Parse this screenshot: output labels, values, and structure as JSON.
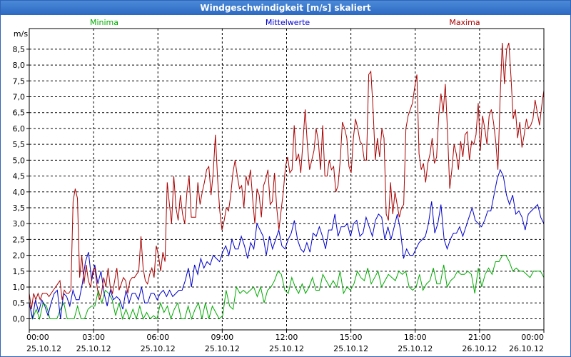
{
  "window": {
    "title": "Windgeschwindigkeit [m/s] skaliert"
  },
  "colors": {
    "min": "#00aa00",
    "mean": "#0000cc",
    "max": "#aa0000",
    "grid": "#000000"
  },
  "chart_data": {
    "type": "line",
    "title": "Windgeschwindigkeit [m/s] skaliert",
    "ylabel": "m/s",
    "xlabel": "",
    "ylim": [
      -0.35,
      9.15
    ],
    "xlim": [
      0,
      24
    ],
    "grid": true,
    "legend_placement": "top",
    "y_ticks": [
      "0,0",
      "0,5",
      "1,0",
      "1,5",
      "2,0",
      "2,5",
      "3,0",
      "3,5",
      "4,0",
      "4,5",
      "5,0",
      "5,5",
      "6,0",
      "6,5",
      "7,0",
      "7,5",
      "8,0",
      "8,5"
    ],
    "x_ticks": [
      {
        "time": "00:00",
        "date": "25.10.12"
      },
      {
        "time": "03:00",
        "date": "25.10.12"
      },
      {
        "time": "06:00",
        "date": "25.10.12"
      },
      {
        "time": "09:00",
        "date": "25.10.12"
      },
      {
        "time": "12:00",
        "date": "25.10.12"
      },
      {
        "time": "15:00",
        "date": "25.10.12"
      },
      {
        "time": "18:00",
        "date": "25.10.12"
      },
      {
        "time": "21:00",
        "date": "26.10.12"
      },
      {
        "time": "00:00",
        "date": "26.10.12"
      }
    ],
    "x_step_hours": 0.1667,
    "series": [
      {
        "name": "Minima",
        "values": [
          0.5,
          0.0,
          0.3,
          0.0,
          0.5,
          0.4,
          0.0,
          0.0,
          0.0,
          0.3,
          0.5,
          0.0,
          0.0,
          0.0,
          0.4,
          0.0,
          0.0,
          0.3,
          0.4,
          0.4,
          0.9,
          0.5,
          0.9,
          0.8,
          0.6,
          0.1,
          0.5,
          0.0,
          0.3,
          0.0,
          0.3,
          0.0,
          0.4,
          0.0,
          0.2,
          0.0,
          0.1,
          0.0,
          0.5,
          0.2,
          0.4,
          0.0,
          0.3,
          0.5,
          0.0,
          0.0,
          0.4,
          0.0,
          0.3,
          0.5,
          0.0,
          0.5,
          0.0,
          0.4,
          0.2,
          0.0,
          0.1,
          0.9,
          0.4,
          0.3,
          1.0,
          0.8,
          0.9,
          0.8,
          0.9,
          1.0,
          0.7,
          1.0,
          0.5,
          0.9,
          1.0,
          1.2,
          1.5,
          1.4,
          0.9,
          0.8,
          1.3,
          1.0,
          0.8,
          1.1,
          0.8,
          1.0,
          1.3,
          0.9,
          0.9,
          1.4,
          1.2,
          1.0,
          1.2,
          1.0,
          1.5,
          0.8,
          1.0,
          0.9,
          1.1,
          1.5,
          1.3,
          1.2,
          1.6,
          1.1,
          1.3,
          1.5,
          1.0,
          1.2,
          1.4,
          1.3,
          1.2,
          1.5,
          1.4,
          1.5,
          1.0,
          0.9,
          1.0,
          1.4,
          0.9,
          1.1,
          1.2,
          1.6,
          1.1,
          1.1,
          1.7,
          1.0,
          1.2,
          1.3,
          1.5,
          1.4,
          1.4,
          1.5,
          1.4,
          0.8,
          1.6,
          1.0,
          1.4,
          1.6,
          1.4,
          1.8,
          1.8,
          2.0,
          2.0,
          1.8,
          1.5,
          1.6,
          1.5,
          1.5,
          1.4,
          1.3,
          1.5,
          1.5,
          1.5,
          1.3
        ]
      },
      {
        "name": "Mittelwerte",
        "values": [
          0.5,
          0.0,
          0.6,
          0.2,
          0.6,
          0.4,
          0.1,
          0.5,
          0.8,
          0.9,
          0.0,
          0.8,
          0.7,
          0.4,
          0.9,
          0.6,
          0.6,
          1.1,
          1.8,
          2.1,
          1.2,
          1.7,
          1.1,
          1.5,
          0.8,
          0.4,
          0.9,
          0.6,
          0.7,
          0.6,
          0.3,
          0.9,
          0.5,
          0.8,
          0.8,
          0.6,
          1.0,
          0.5,
          0.5,
          0.8,
          0.8,
          0.6,
          0.8,
          0.9,
          0.7,
          0.9,
          0.7,
          0.8,
          0.9,
          0.9,
          1.2,
          1.6,
          1.0,
          1.7,
          1.4,
          1.9,
          1.6,
          1.8,
          1.7,
          2.0,
          1.9,
          1.8,
          2.1,
          2.3,
          2.0,
          2.5,
          2.2,
          2.2,
          2.6,
          2.3,
          1.9,
          2.4,
          2.2,
          3.0,
          2.8,
          2.6,
          2.0,
          2.6,
          2.2,
          2.5,
          2.8,
          2.3,
          2.2,
          2.5,
          2.7,
          3.1,
          2.5,
          2.2,
          2.1,
          2.4,
          2.1,
          2.7,
          2.6,
          2.9,
          2.6,
          2.2,
          2.8,
          2.8,
          3.3,
          2.6,
          2.9,
          2.9,
          3.0,
          2.6,
          3.0,
          3.1,
          2.6,
          2.7,
          3.2,
          2.9,
          2.6,
          3.1,
          3.3,
          3.2,
          2.5,
          2.9,
          2.5,
          2.9,
          3.3,
          2.8,
          1.9,
          2.2,
          2.0,
          2.0,
          2.2,
          2.4,
          2.5,
          2.6,
          3.0,
          3.7,
          2.7,
          3.0,
          3.6,
          2.5,
          2.2,
          2.5,
          2.7,
          2.7,
          2.9,
          2.6,
          2.9,
          3.2,
          3.5,
          3.1,
          3.0,
          2.9,
          3.1,
          3.4,
          3.4,
          3.9,
          4.4,
          4.7,
          4.5,
          3.9,
          3.6,
          3.9,
          3.3,
          3.4,
          3.2,
          2.8,
          3.3,
          3.4,
          3.5,
          3.6,
          3.2,
          3.0
        ]
      },
      {
        "name": "Maxima",
        "values": [
          0.8,
          0.3,
          0.8,
          0.6,
          0.8,
          0.6,
          0.8,
          0.8,
          0.8,
          0.7,
          0.8,
          0.9,
          1.0,
          1.1,
          1.2,
          0.6,
          0.9,
          0.8,
          0.8,
          0.9,
          3.7,
          4.1,
          3.8,
          1.3,
          2.0,
          1.1,
          1.7,
          1.2,
          1.0,
          1.5,
          1.6,
          1.0,
          0.6,
          0.8,
          1.3,
          1.0,
          1.6,
          1.0,
          0.8,
          1.2,
          1.6,
          0.9,
          1.1,
          1.3,
          1.2,
          0.8,
          1.2,
          1.3,
          1.3,
          1.4,
          1.5,
          2.6,
          1.6,
          1.2,
          1.1,
          1.4,
          1.6,
          1.3,
          2.3,
          2.0,
          1.5,
          2.1,
          1.8,
          4.3,
          3.6,
          3.0,
          4.5,
          3.5,
          3.1,
          3.9,
          3.3,
          3.0,
          4.0,
          4.5,
          3.2,
          3.2,
          3.2,
          4.3,
          3.6,
          4.0,
          4.3,
          4.7,
          4.8,
          3.9,
          4.6,
          5.8,
          4.4,
          3.4,
          2.8,
          3.1,
          3.5,
          3.4,
          3.9,
          4.6,
          5.0,
          4.5,
          4.1,
          4.2,
          3.5,
          4.5,
          4.2,
          4.7,
          3.8,
          3.0,
          4.1,
          3.9,
          3.2,
          4.2,
          4.4,
          4.7,
          3.6,
          3.7,
          4.6,
          3.5,
          2.8,
          3.4,
          4.0,
          4.8,
          5.1,
          4.6,
          4.7,
          6.1,
          5.0,
          5.2,
          4.6,
          5.6,
          6.6,
          5.5,
          4.7,
          5.0,
          5.3,
          6.0,
          5.6,
          4.7,
          6.1,
          4.5,
          4.5,
          5.0,
          4.7,
          4.8,
          4.0,
          4.2,
          5.0,
          6.2,
          6.0,
          5.7,
          4.8,
          4.6,
          5.7,
          6.3,
          6.0,
          5.6,
          5.5,
          5.0,
          5.0,
          7.7,
          7.8,
          6.6,
          5.0,
          5.7,
          5.1,
          6.0,
          5.7,
          3.3,
          3.1,
          4.3,
          3.3,
          4.0,
          3.6,
          3.2,
          3.5,
          3.6,
          6.0,
          6.4,
          6.6,
          6.8,
          7.3,
          7.7,
          5.2,
          4.7,
          4.9,
          4.3,
          4.9,
          5.2,
          5.7,
          4.9,
          5.1,
          6.4,
          7.1,
          6.5,
          7.4,
          5.9,
          4.1,
          4.7,
          5.5,
          5.2,
          4.7,
          5.6,
          5.1,
          5.8,
          5.9,
          5.0,
          5.6,
          5.5,
          5.8,
          6.8,
          5.3,
          6.4,
          6.0,
          5.5,
          6.4,
          6.6,
          6.2,
          5.6,
          4.7,
          6.9,
          8.7,
          7.4,
          8.5,
          8.7,
          7.6,
          6.3,
          6.6,
          5.7,
          6.2,
          5.4,
          5.8,
          6.3,
          6.0,
          6.1,
          6.3,
          6.9,
          6.5,
          6.1,
          6.7,
          7.2
        ]
      }
    ]
  }
}
